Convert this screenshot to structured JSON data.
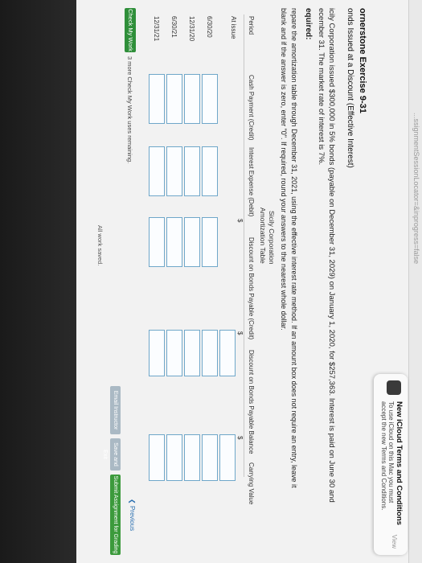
{
  "browser": {
    "url_fragment": "...ssignmentSessionLocator=&inprogress=false"
  },
  "notification": {
    "title": "New iCloud Terms and Conditions",
    "body": "To use iCloud on this Mac you must accept the new Terms and Conditions.",
    "action": "View"
  },
  "exercise": {
    "title": "ornerstone Exercise 9-31",
    "subtitle": "onds Issued at a Discount (Effective Interest)",
    "description_line1": "icily Corporation issued $300,000 in 5% bonds (payable on December 31, 2029) on January 1, 2020, for $257,363. Interest is paid on June 30 and",
    "description_line2": "ecember 31. The market rate of interest is 7%.",
    "required_label": "equired:",
    "instruction_line1": "repare the amortization table through December 31, 2021, using the effective interest rate method. If an amount box does not require an entry, leave it",
    "instruction_line2": "blank and if the answer is zero, enter \"0\". If required, round your answers to the nearest whole dollar."
  },
  "table": {
    "company": "Sicily Corporation",
    "name": "Amortization Table",
    "headers": [
      "Period",
      "Cash Payment (Credit)",
      "Interest Expense (Debit)",
      "Discount on Bonds Payable (Credit)",
      "Discount on Bonds Payable Balance",
      "Carrying Value"
    ],
    "currency": "$",
    "rows": [
      {
        "period": "At issue"
      },
      {
        "period": "6/30/20"
      },
      {
        "period": "12/31/20"
      },
      {
        "period": "6/30/21"
      },
      {
        "period": "12/31/21"
      }
    ]
  },
  "footer": {
    "check_button": "Check My Work",
    "remaining": "3 more Check My Work uses remaining.",
    "previous": "Previous",
    "email_instructor": "Email Instructor",
    "save_exit": "Save and Exit",
    "submit": "Submit Assignment for Grading",
    "saved": "All work saved."
  },
  "colors": {
    "check_green": "#2f8f3a",
    "submit_green": "#3c9a3c",
    "link_blue": "#2a6fb0",
    "input_border": "#6fa7c9"
  }
}
